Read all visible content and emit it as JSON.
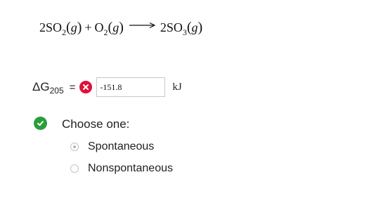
{
  "equation": {
    "reactant1_coef": "2",
    "reactant1_formula": "SO",
    "reactant1_sub": "2",
    "reactant1_phase": "g",
    "plus": "+",
    "reactant2_formula": "O",
    "reactant2_sub": "2",
    "reactant2_phase": "g",
    "product_coef": "2",
    "product_formula": "SO",
    "product_sub": "3",
    "product_phase": "g"
  },
  "delta_g": {
    "symbol": "ΔG",
    "subscript": "205",
    "equals": "=",
    "status": "incorrect",
    "status_color": "#e0103a",
    "input_value": "-151.8",
    "unit": "kJ"
  },
  "choice": {
    "status": "correct",
    "status_color": "#2a9d3c",
    "prompt": "Choose one:",
    "options": [
      {
        "label": "Spontaneous",
        "selected": true
      },
      {
        "label": "Nonspontaneous",
        "selected": false
      }
    ]
  }
}
